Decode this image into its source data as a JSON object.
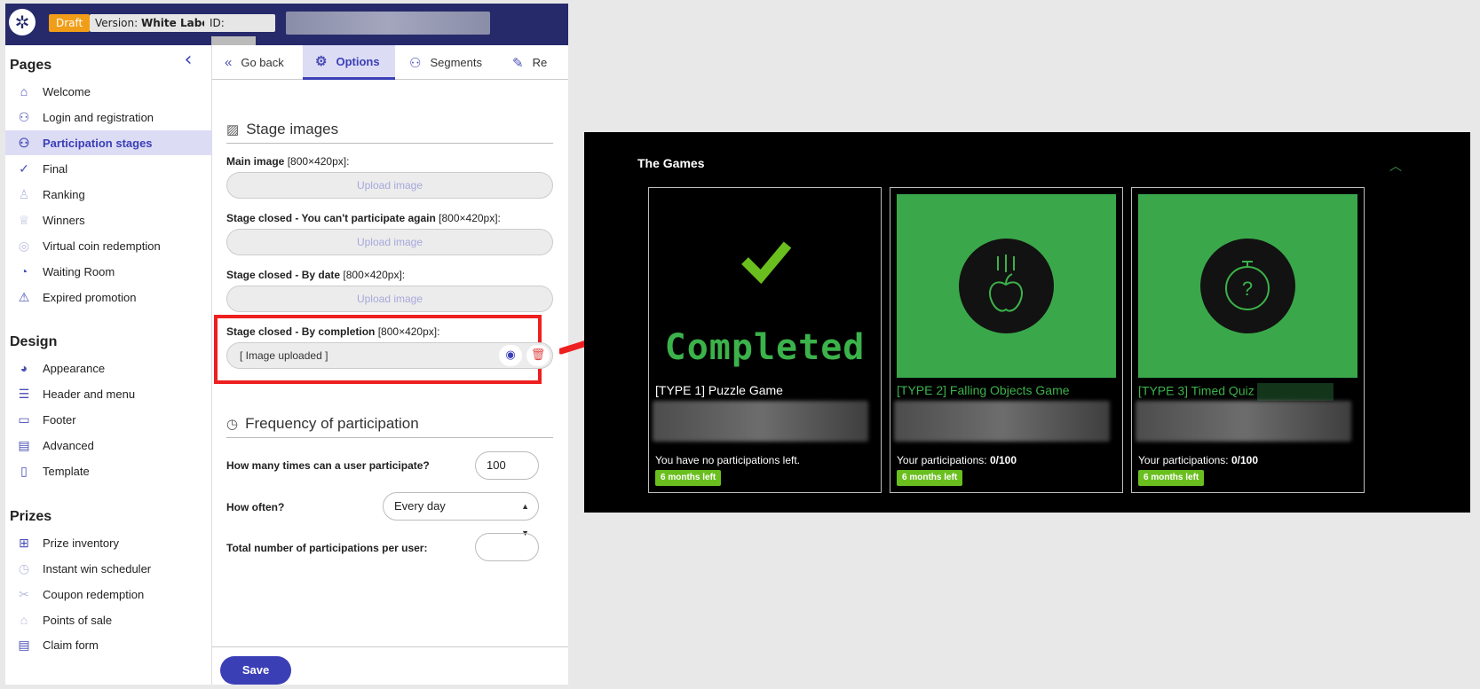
{
  "topbar": {
    "logo_glyph": "✲",
    "draft_label": "Draft",
    "version_prefix": "Version:",
    "version_value": "White Label",
    "id_label": "ID:"
  },
  "sidebar": {
    "pages_title": "Pages",
    "pages_items": [
      {
        "label": "Welcome",
        "icon": "home-icon",
        "glyph": "⌂"
      },
      {
        "label": "Login and registration",
        "icon": "user-key-icon",
        "glyph": "⚇"
      },
      {
        "label": "Participation stages",
        "icon": "participants-icon",
        "glyph": "⚇"
      },
      {
        "label": "Final",
        "icon": "checkmark-icon",
        "glyph": "✓"
      },
      {
        "label": "Ranking",
        "icon": "ranking-icon",
        "glyph": "♙"
      },
      {
        "label": "Winners",
        "icon": "trophy-icon",
        "glyph": "♕"
      },
      {
        "label": "Virtual coin redemption",
        "icon": "coin-icon",
        "glyph": "◎"
      },
      {
        "label": "Waiting Room",
        "icon": "speedometer-icon",
        "glyph": "◔"
      },
      {
        "label": "Expired promotion",
        "icon": "warning-icon",
        "glyph": "⚠"
      }
    ],
    "design_title": "Design",
    "design_items": [
      {
        "label": "Appearance",
        "icon": "palette-icon",
        "glyph": "◕"
      },
      {
        "label": "Header and menu",
        "icon": "menu-icon",
        "glyph": "☰"
      },
      {
        "label": "Footer",
        "icon": "footer-icon",
        "glyph": "▭"
      },
      {
        "label": "Advanced",
        "icon": "advanced-icon",
        "glyph": "▤"
      },
      {
        "label": "Template",
        "icon": "document-icon",
        "glyph": "▯"
      }
    ],
    "prizes_title": "Prizes",
    "prizes_items": [
      {
        "label": "Prize inventory",
        "icon": "gift-icon",
        "glyph": "⊞"
      },
      {
        "label": "Instant win scheduler",
        "icon": "clock-icon",
        "glyph": "◷"
      },
      {
        "label": "Coupon redemption",
        "icon": "coupon-icon",
        "glyph": "✂"
      },
      {
        "label": "Points of sale",
        "icon": "store-icon",
        "glyph": "⌂"
      },
      {
        "label": "Claim form",
        "icon": "form-icon",
        "glyph": "▤"
      }
    ]
  },
  "tabs": [
    {
      "label": "Go back",
      "icon": "double-chevron-left-icon",
      "glyph": "«"
    },
    {
      "label": "Options",
      "icon": "gear-icon",
      "glyph": "⚙"
    },
    {
      "label": "Segments",
      "icon": "users-icon",
      "glyph": "⚇"
    },
    {
      "label": "Re",
      "icon": "pen-icon",
      "glyph": "✎"
    }
  ],
  "stage_images": {
    "title": "Stage images",
    "main_label": "Main image",
    "main_size": "[800×420px]:",
    "closed_again_label": "Stage closed - You can't participate again",
    "closed_again_size": "[800×420px]:",
    "closed_date_label": "Stage closed - By date",
    "closed_date_size": "[800×420px]:",
    "closed_completion_label": "Stage closed - By completion",
    "closed_completion_size": "[800×420px]:",
    "upload_label": "Upload image",
    "uploaded_text": "[ Image uploaded ]"
  },
  "frequency": {
    "title": "Frequency of participation",
    "times_label": "How many times can a user participate?",
    "times_value": "100",
    "how_often_label": "How often?",
    "how_often_value": "Every day",
    "total_label": "Total number of participations per user:",
    "total_value": ""
  },
  "save_label": "Save",
  "games": {
    "title": "The Games",
    "cards": [
      {
        "name": "[TYPE 1] Puzzle Game",
        "overlay": "Completed",
        "status_prefix": "You have no participations left.",
        "status_value": "",
        "badge": "6 months left"
      },
      {
        "name": "[TYPE 2] Falling Objects Game",
        "status_prefix": "Your participations:",
        "status_value": "0/100",
        "badge": "6 months left"
      },
      {
        "name": "[TYPE 3] Timed Quiz",
        "status_prefix": "Your participations:",
        "status_value": "0/100",
        "badge": "6 months left"
      }
    ]
  },
  "colors": {
    "topbar": "#262a6b",
    "accent": "#3b3fb6",
    "draft": "#f29d17",
    "highlight": "#ee1f1f",
    "game_green": "#3bb24a",
    "badge_green": "#6abf1f"
  }
}
